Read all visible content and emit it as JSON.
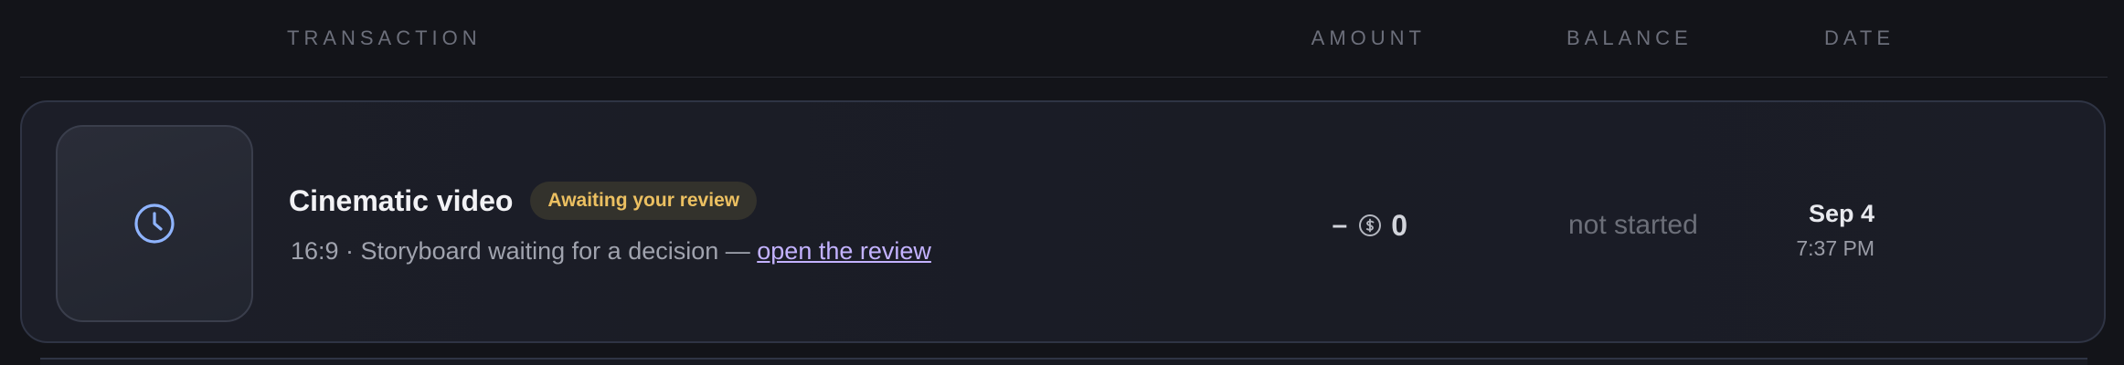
{
  "columns": {
    "transaction": "TRANSACTION",
    "amount": "AMOUNT",
    "balance": "BALANCE",
    "date": "DATE"
  },
  "rows": [
    {
      "icon": "clock-icon",
      "title": "Cinematic video",
      "badge": "Awaiting your review",
      "subtitle_prefix": "16:9 · Storyboard waiting for a decision — ",
      "link_text": "open the review",
      "amount_sign": "–",
      "amount_icon": "coin-icon",
      "amount_value": "0",
      "balance": "not started",
      "date": "Sep 4",
      "time": "7:37 PM"
    }
  ],
  "colors": {
    "background": "#131419",
    "card_border": "#2f3444",
    "badge_text": "#ecc061",
    "badge_bg": "#33322c",
    "link": "#c3b2ff",
    "icon_accent": "#8fb4ff"
  }
}
